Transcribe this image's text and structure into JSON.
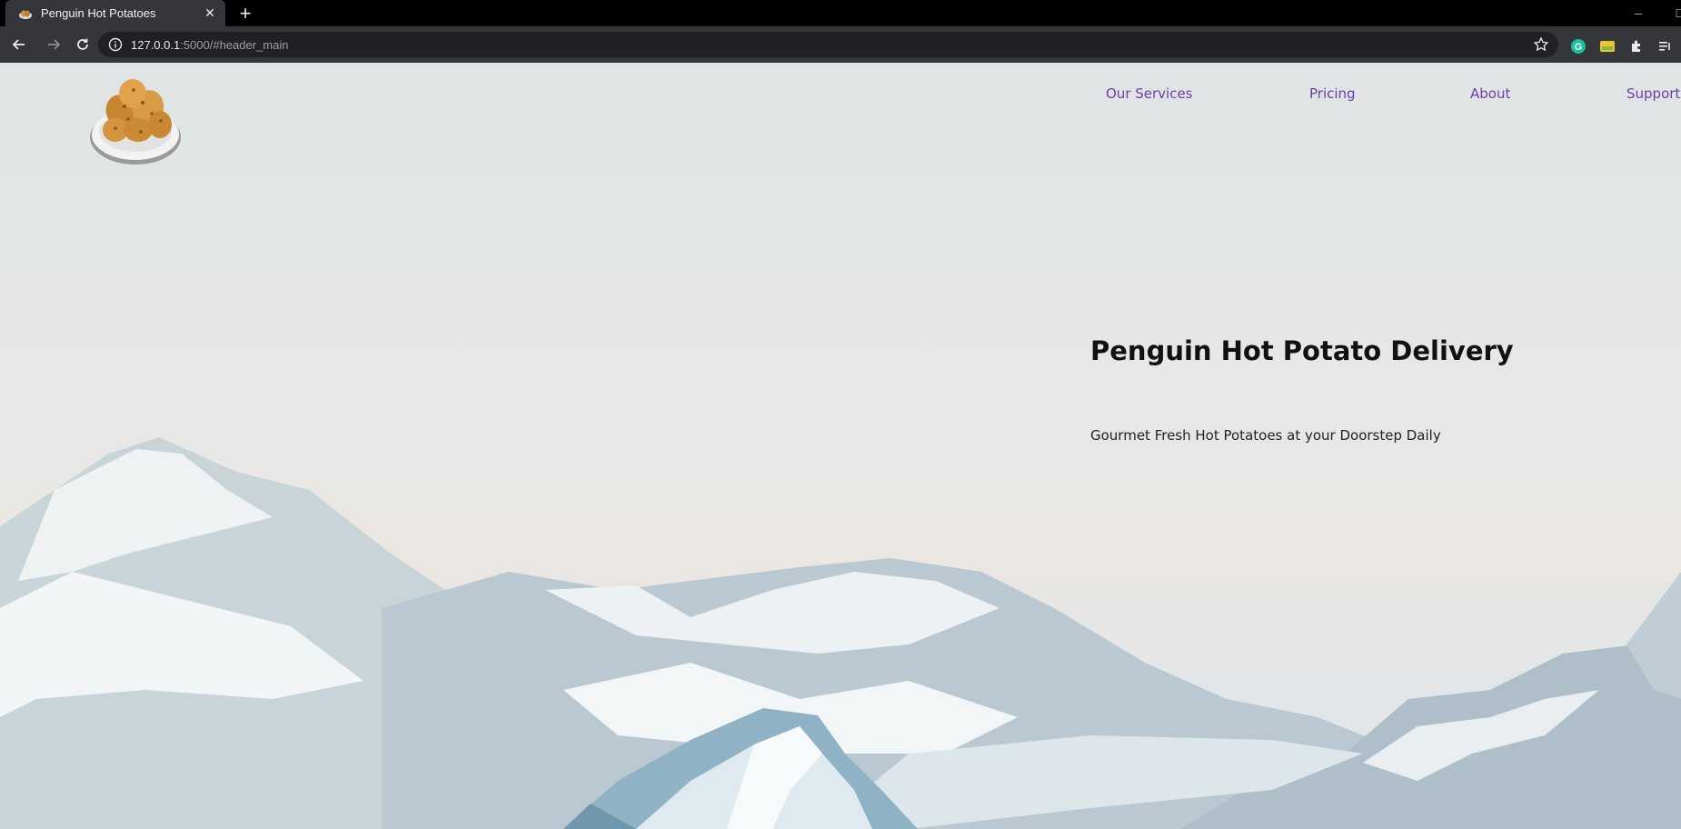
{
  "browser": {
    "tab": {
      "title": "Penguin Hot Potatoes",
      "favicon": "potato-icon"
    },
    "url": {
      "host": "127.0.0.1",
      "rest": ":5000/#header_main"
    },
    "extensions": [
      "grammarly-icon",
      "extension-colorful-icon",
      "puzzle-icon",
      "media-control-icon"
    ]
  },
  "site": {
    "logo": "potato-plate-logo",
    "nav": [
      {
        "label": "Our Services"
      },
      {
        "label": "Pricing"
      },
      {
        "label": "About"
      },
      {
        "label": "Support"
      }
    ],
    "hero": {
      "title": "Penguin Hot Potato Delivery",
      "subtitle": "Gourmet Fresh Hot Potatoes at your Doorstep Daily"
    },
    "colors": {
      "nav_link": "#6a3fa8",
      "chrome_bg": "#35363a",
      "omnibox_bg": "#202124"
    }
  }
}
